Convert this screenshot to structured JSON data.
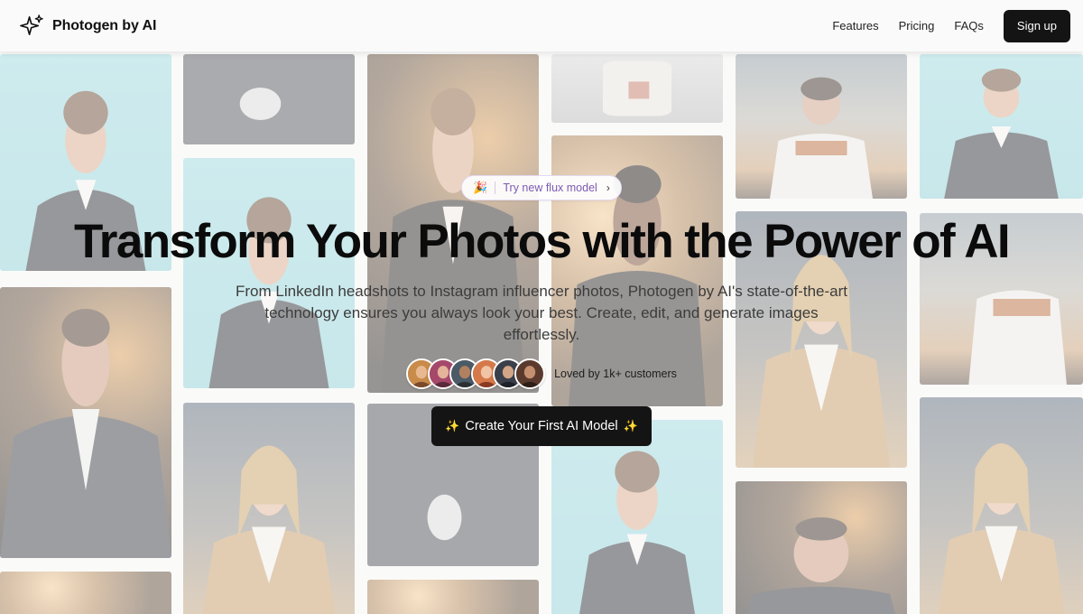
{
  "header": {
    "brand_name": "Photogen by AI",
    "brand_icon": "sparkles-icon",
    "nav": [
      "Features",
      "Pricing",
      "FAQs"
    ],
    "signup_label": "Sign up"
  },
  "hero": {
    "badge_emoji": "🎉",
    "badge_label": "Try new flux model",
    "badge_chevron": "›",
    "title": "Transform Your Photos with the Power of AI",
    "subtitle": "From LinkedIn headshots to Instagram influencer photos, Photogen by AI's state-of-the-art technology ensures you always look your best. Create, edit, and generate images effortlessly.",
    "social_proof": "Loved by 1k+ customers",
    "cta_spark": "✨",
    "cta_label": "Create Your First AI Model"
  },
  "colors": {
    "dark": "#141414",
    "badge_text": "#7c5ab3",
    "page_bg": "#f4f4f2"
  }
}
